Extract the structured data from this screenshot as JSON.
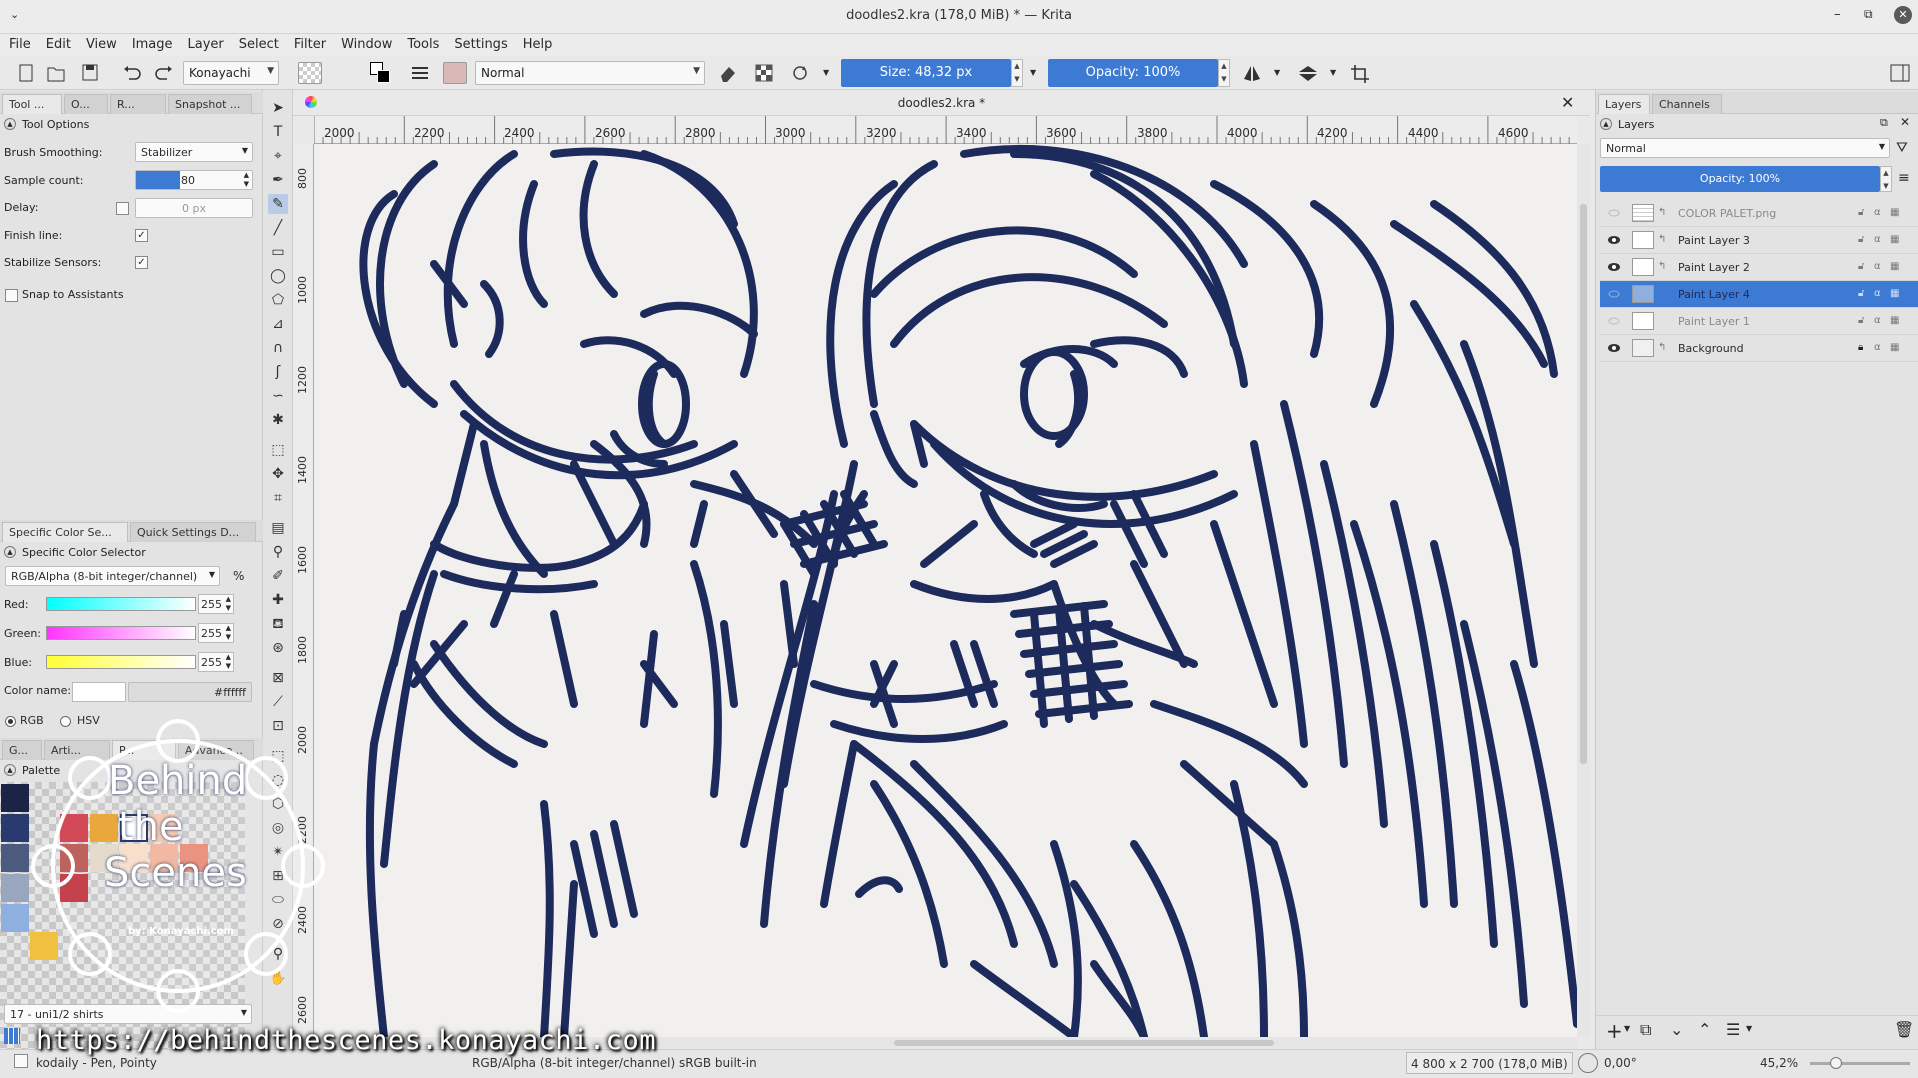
{
  "window": {
    "title": "doodles2.kra (178,0 MiB)  * — Krita"
  },
  "menu": [
    "File",
    "Edit",
    "View",
    "Image",
    "Layer",
    "Select",
    "Filter",
    "Window",
    "Tools",
    "Settings",
    "Help"
  ],
  "toolbar": {
    "workspace": "Konayachi",
    "blend_mode": "Normal",
    "size_label": "Size: 48,32 px",
    "opacity_label": "Opacity: 100%"
  },
  "tool_tabs": [
    "Tool ...",
    "O...",
    "R...",
    "Snapshot ..."
  ],
  "tool_options": {
    "header": "Tool Options",
    "brush_smoothing_label": "Brush Smoothing:",
    "brush_smoothing_value": "Stabilizer",
    "sample_count_label": "Sample count:",
    "sample_count_value": "80",
    "delay_label": "Delay:",
    "delay_value": "0 px",
    "finish_line_label": "Finish line:",
    "stabilize_label": "Stabilize Sensors:",
    "snap_label": "Snap to Assistants"
  },
  "color_tabs": [
    "Specific Color Se...",
    "Quick Settings D..."
  ],
  "color_selector": {
    "header": "Specific Color Selector",
    "model": "RGB/Alpha (8-bit integer/channel)",
    "percent": "%",
    "red_label": "Red:",
    "red": "255",
    "green_label": "Green:",
    "green": "255",
    "blue_label": "Blue:",
    "blue": "255",
    "color_name_label": "Color name:",
    "color_name": "#ffffff",
    "rgb": "RGB",
    "hsv": "HSV"
  },
  "bottom_tabs": [
    "G...",
    "Arti...",
    "P...",
    "Advance..."
  ],
  "palette": {
    "header": "Palette",
    "name": "17 - uni1/2 shirts"
  },
  "canvas": {
    "doc_tab": "doodles2.kra *",
    "ruler_h": [
      "2000",
      "2200",
      "2400",
      "2600",
      "2800",
      "3000",
      "3200",
      "3400",
      "3600",
      "3800",
      "4000",
      "4200",
      "4400",
      "4600"
    ],
    "ruler_v": [
      "800",
      "1000",
      "1200",
      "1400",
      "1600",
      "1800",
      "2000",
      "2200",
      "2400",
      "2600"
    ]
  },
  "right_tabs": [
    "Layers",
    "Channels"
  ],
  "layers_panel": {
    "header": "Layers",
    "blend": "Normal",
    "opacity": "Opacity:  100%",
    "layers": [
      {
        "name": "COLOR PALET.png",
        "visible": false,
        "selected": false
      },
      {
        "name": "Paint Layer 3",
        "visible": true,
        "selected": false
      },
      {
        "name": "Paint Layer 2",
        "visible": true,
        "selected": false
      },
      {
        "name": "Paint Layer 4",
        "visible": false,
        "selected": true
      },
      {
        "name": "Paint Layer 1",
        "visible": false,
        "selected": false
      },
      {
        "name": "Background",
        "visible": true,
        "selected": false
      }
    ]
  },
  "status": {
    "brush": "kodaily - Pen, Pointy",
    "colorspace": "RGB/Alpha (8-bit integer/channel)  sRGB built-in",
    "dimensions": "4 800 x 2 700 (178,0 MiB)",
    "rotation": "0,00°",
    "zoom": "45,2%"
  },
  "watermark": {
    "line1": "Behind",
    "line2": "the",
    "line3": "Scenes",
    "by": "by: Konayachi.com",
    "url": "https://behindthescenes.konayachi.com"
  },
  "colors": {
    "accent": "#3d7ad4",
    "ink": "#1c2a5c",
    "canvas": "#f1f0ee"
  }
}
